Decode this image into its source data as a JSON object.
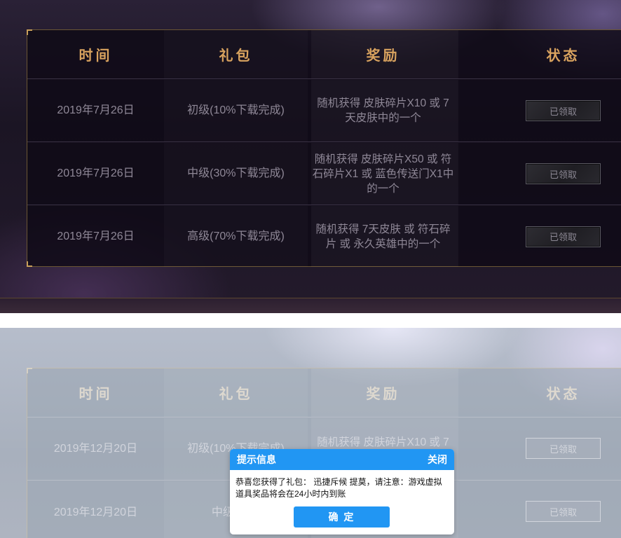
{
  "headers": {
    "time": "时间",
    "pack": "礼包",
    "reward": "奖励",
    "status": "状态"
  },
  "top_table": {
    "rows": [
      {
        "time": "2019年7月26日",
        "pack": "初级(10%下载完成)",
        "reward": "随机获得 皮肤碎片X10 或 7天皮肤中的一个",
        "status": "已领取"
      },
      {
        "time": "2019年7月26日",
        "pack": "中级(30%下载完成)",
        "reward": "随机获得 皮肤碎片X50 或 符石碎片X1 或 蓝色传送门X1中的一个",
        "status": "已领取"
      },
      {
        "time": "2019年7月26日",
        "pack": "高级(70%下载完成)",
        "reward": "随机获得 7天皮肤 或 符石碎片 或 永久英雄中的一个",
        "status": "已领取"
      }
    ]
  },
  "bottom_table": {
    "rows": [
      {
        "time": "2019年12月20日",
        "pack": "初级(10%下载完成)",
        "reward": "随机获得 皮肤碎片X10 或 7",
        "status": "已领取"
      },
      {
        "time": "2019年12月20日",
        "pack": "中级(30%",
        "reward": "",
        "status": "已领取"
      }
    ]
  },
  "dialog": {
    "title": "提示信息",
    "close_label": "关闭",
    "message": "恭喜您获得了礼包： 迅捷斥候 提莫，请注意：游戏虚拟道具奖品将会在24小时内到账",
    "confirm_label": "确 定"
  },
  "colors": {
    "accent_gold": "#d9a35f",
    "dialog_blue": "#2196f3"
  }
}
